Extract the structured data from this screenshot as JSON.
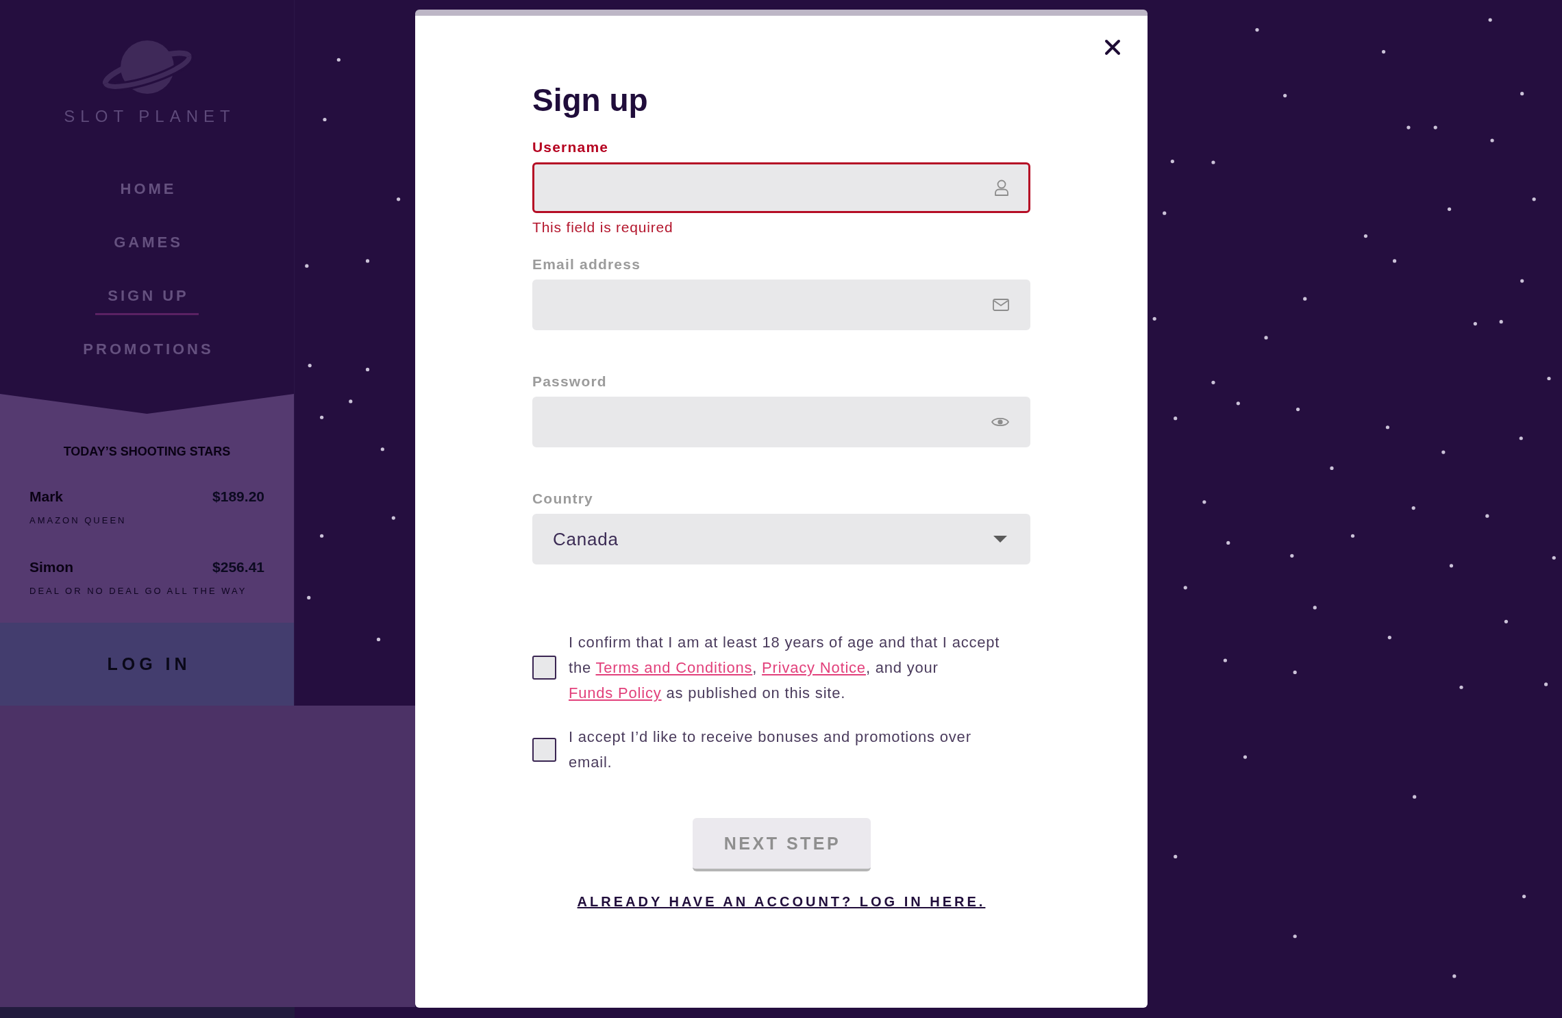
{
  "sidebar": {
    "logo": {
      "wordmark": "SLOT PLANET"
    },
    "nav": [
      {
        "label": "HOME",
        "selected": false
      },
      {
        "label": "GAMES",
        "selected": false
      },
      {
        "label": "SIGN UP",
        "selected": true
      },
      {
        "label": "PROMOTIONS",
        "selected": false
      }
    ],
    "shooting_stars": {
      "title": "TODAY’S SHOOTING STARS",
      "winners": [
        {
          "name": "Mark",
          "amount": "$189.20",
          "game": "AMAZON QUEEN"
        },
        {
          "name": "Simon",
          "amount": "$256.41",
          "game": "DEAL OR NO DEAL GO ALL THE WAY"
        }
      ]
    },
    "login_button": {
      "label": "LOG IN"
    }
  },
  "modal": {
    "title": "Sign up",
    "fields": [
      {
        "kind": "username",
        "label": "Username",
        "invalid": true,
        "error": "This field is required"
      },
      {
        "kind": "email",
        "label": "Email address",
        "invalid": false
      },
      {
        "kind": "password",
        "label": "Password",
        "invalid": false
      },
      {
        "kind": "country",
        "label": "Country",
        "value": "Canada",
        "invalid": false
      }
    ],
    "consents": [
      {
        "checked": false,
        "segments": [
          {
            "kind": "text",
            "text": "I confirm that I am at least 18 years of age and that I accept the "
          },
          {
            "kind": "link",
            "text": "Terms and Conditions"
          },
          {
            "kind": "text",
            "text": ", "
          },
          {
            "kind": "link",
            "text": "Privacy Notice"
          },
          {
            "kind": "text",
            "text": ", and your "
          },
          {
            "kind": "link",
            "text": "Funds Policy"
          },
          {
            "kind": "text",
            "text": " as published on this site."
          }
        ]
      },
      {
        "checked": false,
        "segments": [
          {
            "kind": "text",
            "text": "I accept I’d like to receive bonuses and promotions over email."
          }
        ]
      }
    ],
    "next_button": {
      "label": "NEXT STEP",
      "disabled": true
    },
    "login_link": {
      "label": "ALREADY HAVE AN ACCOUNT? LOG IN HERE."
    }
  }
}
